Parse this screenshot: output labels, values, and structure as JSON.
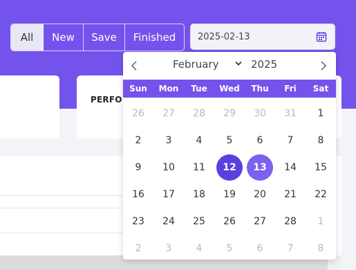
{
  "filters": {
    "items": [
      {
        "label": "All",
        "active": true,
        "width": 47
      },
      {
        "label": "New",
        "active": false,
        "width": 58
      },
      {
        "label": "Save",
        "active": false,
        "width": 60
      },
      {
        "label": "Finished",
        "active": false,
        "width": 85
      }
    ]
  },
  "date_input": {
    "value": "2025-02-13"
  },
  "cards": {
    "mid_title": "PERFO"
  },
  "datepicker": {
    "month": "February",
    "year": "2025",
    "weekdays": [
      "Sun",
      "Mon",
      "Tue",
      "Wed",
      "Thu",
      "Fri",
      "Sat"
    ],
    "days": [
      {
        "d": "26",
        "m": true
      },
      {
        "d": "27",
        "m": true
      },
      {
        "d": "28",
        "m": true
      },
      {
        "d": "29",
        "m": true
      },
      {
        "d": "30",
        "m": true
      },
      {
        "d": "31",
        "m": true
      },
      {
        "d": "1"
      },
      {
        "d": "2"
      },
      {
        "d": "3"
      },
      {
        "d": "4"
      },
      {
        "d": "5"
      },
      {
        "d": "6"
      },
      {
        "d": "7"
      },
      {
        "d": "8"
      },
      {
        "d": "9"
      },
      {
        "d": "10"
      },
      {
        "d": "11"
      },
      {
        "d": "12",
        "s": "selected"
      },
      {
        "d": "13",
        "s": "range"
      },
      {
        "d": "14"
      },
      {
        "d": "15"
      },
      {
        "d": "16"
      },
      {
        "d": "17"
      },
      {
        "d": "18"
      },
      {
        "d": "19"
      },
      {
        "d": "20"
      },
      {
        "d": "21"
      },
      {
        "d": "22"
      },
      {
        "d": "23"
      },
      {
        "d": "24"
      },
      {
        "d": "25"
      },
      {
        "d": "26"
      },
      {
        "d": "27"
      },
      {
        "d": "28"
      },
      {
        "d": "1",
        "m": true
      },
      {
        "d": "2",
        "m": true
      },
      {
        "d": "3",
        "m": true
      },
      {
        "d": "4",
        "m": true
      },
      {
        "d": "5",
        "m": true
      },
      {
        "d": "6",
        "m": true
      },
      {
        "d": "7",
        "m": true
      },
      {
        "d": "8",
        "m": true
      }
    ]
  },
  "colors": {
    "accent": "#7452ec",
    "selected": "#5b3fe0",
    "range": "#7c60ee"
  },
  "icons": {
    "prev": "chevron-left-icon",
    "next": "chevron-right-icon",
    "calendar": "calendar-icon"
  }
}
